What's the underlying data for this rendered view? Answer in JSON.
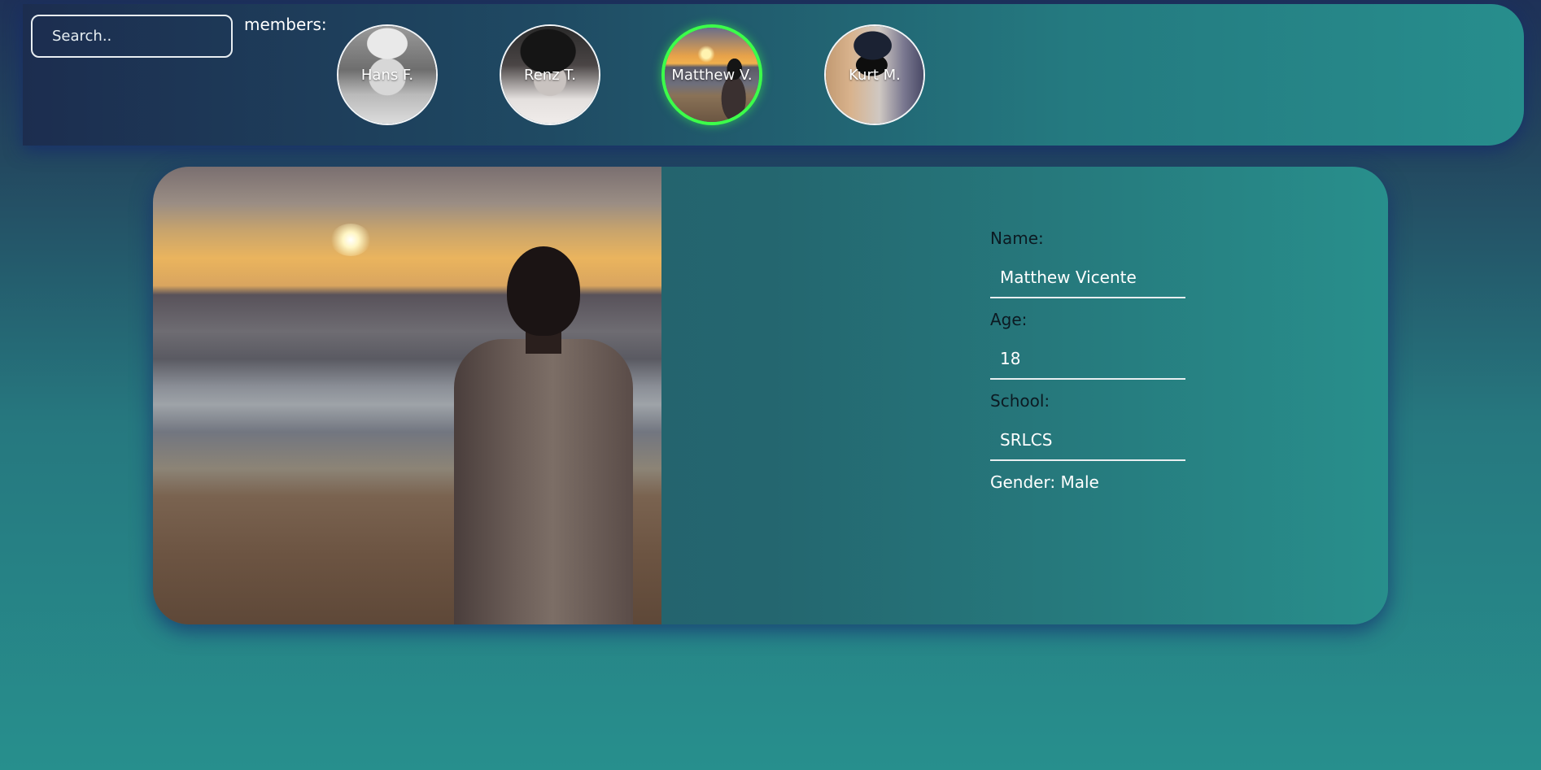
{
  "search": {
    "placeholder": "Search.."
  },
  "members_label": "members:",
  "members": [
    {
      "name": "Hans F.",
      "active": false
    },
    {
      "name": "Renz T.",
      "active": false
    },
    {
      "name": "Matthew V.",
      "active": true
    },
    {
      "name": "Kurt M.",
      "active": false
    }
  ],
  "profile": {
    "name_label": "Name:",
    "name_value": "Matthew Vicente",
    "age_label": "Age:",
    "age_value": "18",
    "school_label": "School:",
    "school_value": "SRLCS",
    "gender_text": "Gender: Male"
  },
  "colors": {
    "active_ring": "#3cff4a",
    "label_text": "#0c1a22",
    "value_text": "#ffffff"
  }
}
